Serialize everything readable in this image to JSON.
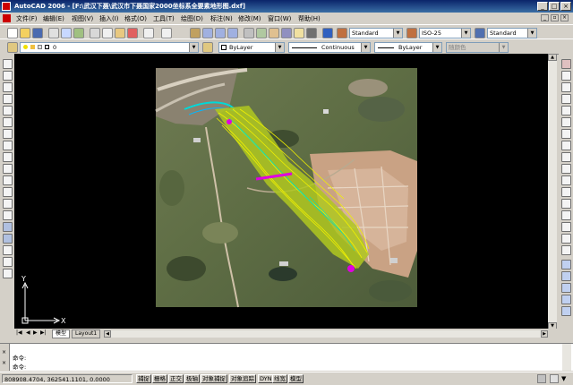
{
  "window": {
    "title": "AutoCAD 2006 - [F:\\武汉下聂\\武汉市下聂国家2000坐标系全要素地形图.dxf]"
  },
  "menu": [
    "文件(F)",
    "编辑(E)",
    "视图(V)",
    "插入(I)",
    "格式(O)",
    "工具(T)",
    "绘图(D)",
    "标注(N)",
    "修改(M)",
    "窗口(W)",
    "帮助(H)"
  ],
  "styles": {
    "text_style": "Standard",
    "dim_style": "ISO-25",
    "table_style": "Standard"
  },
  "layer": {
    "current": "0"
  },
  "properties": {
    "color": "ByLayer",
    "linetype": "Continuous",
    "lineweight": "ByLayer",
    "plotstyle": "随颜色"
  },
  "ucs": {
    "x_label": "X",
    "y_label": "Y"
  },
  "layout_tabs": [
    "模型",
    "Layout1"
  ],
  "command_lines": [
    "命令:",
    "命令:"
  ],
  "command_markers": [
    "×",
    "×"
  ],
  "status": {
    "coordinates": "808908.4704, 362541.1101, 0.0000",
    "buttons": [
      "捕捉",
      "栅格",
      "正交",
      "极轴",
      "对象捕捉",
      "对象追踪",
      "DYN",
      "线宽",
      "模型"
    ]
  },
  "icons": {
    "app": "autocad-app-icon",
    "window_controls": [
      "minimize-icon",
      "maximize-icon",
      "close-icon"
    ],
    "doc_controls": [
      "minimize-icon",
      "restore-icon",
      "close-icon"
    ]
  },
  "colors": {
    "titlebar": "#0a246a",
    "canvas": "#000000",
    "contour": "#e8f000",
    "cyan": "#00d8d8",
    "magenta": "#e000e0"
  }
}
